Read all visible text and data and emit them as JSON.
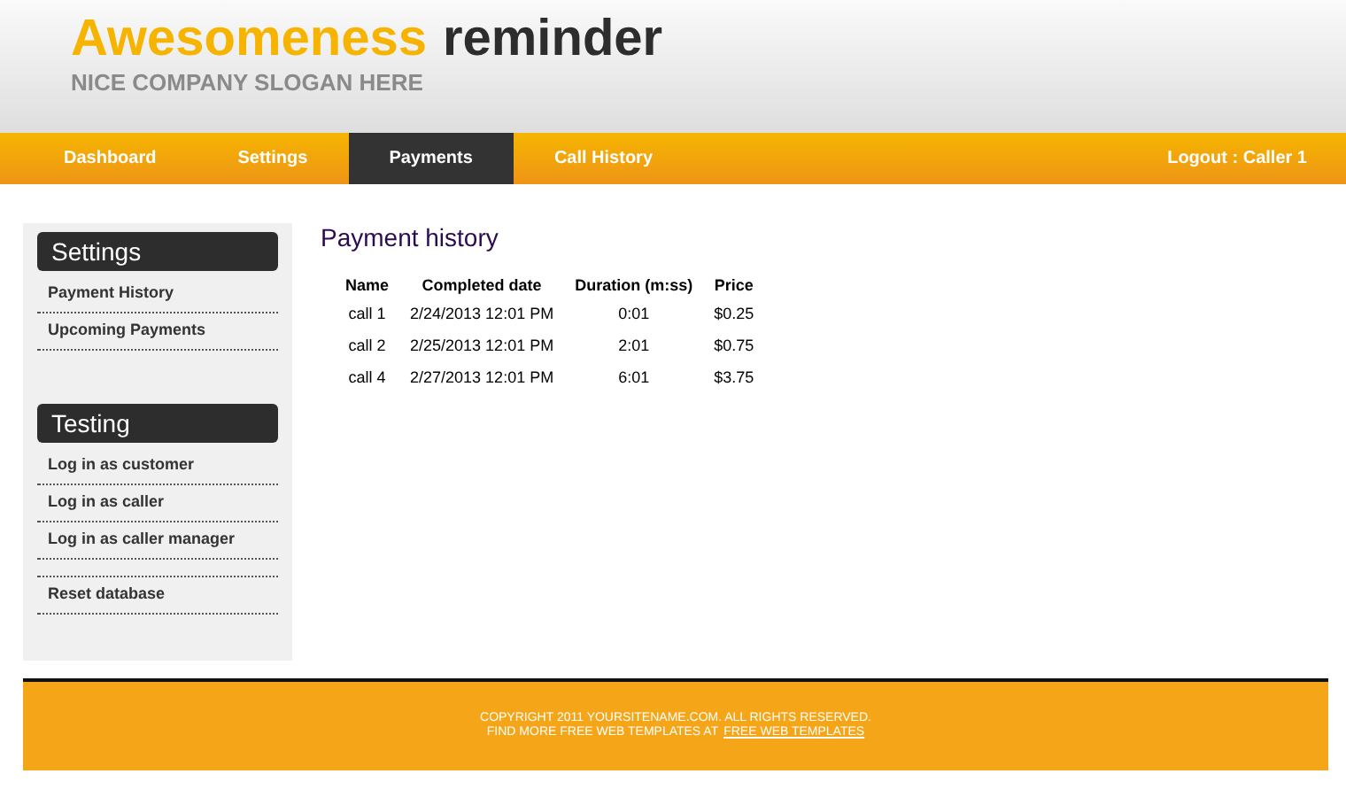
{
  "header": {
    "title_accent": "Awesomeness",
    "title_rest": "reminder",
    "slogan": "NICE COMPANY SLOGAN HERE"
  },
  "nav": {
    "items": [
      {
        "label": "Dashboard",
        "selected": false
      },
      {
        "label": "Settings",
        "selected": false
      },
      {
        "label": "Payments",
        "selected": true
      },
      {
        "label": "Call History",
        "selected": false
      }
    ],
    "logout": "Logout : Caller 1"
  },
  "sidebar": {
    "sections": [
      {
        "title": "Settings",
        "items": [
          {
            "kind": "link",
            "label": "Payment History"
          },
          {
            "kind": "link",
            "label": "Upcoming Payments"
          }
        ]
      },
      {
        "title": "Testing",
        "items": [
          {
            "kind": "link",
            "label": "Log in as customer"
          },
          {
            "kind": "link",
            "label": "Log in as caller"
          },
          {
            "kind": "link",
            "label": "Log in as caller manager"
          },
          {
            "kind": "spacer"
          },
          {
            "kind": "link",
            "label": "Reset database"
          }
        ]
      }
    ]
  },
  "content": {
    "heading": "Payment history",
    "table": {
      "columns": [
        "Name",
        "Completed date",
        "Duration (m:ss)",
        "Price"
      ],
      "rows": [
        [
          "call 1",
          "2/24/2013 12:01 PM",
          "0:01",
          "$0.25"
        ],
        [
          "call 2",
          "2/25/2013 12:01 PM",
          "2:01",
          "$0.75"
        ],
        [
          "call 4",
          "2/27/2013 12:01 PM",
          "6:01",
          "$3.75"
        ]
      ]
    }
  },
  "footer": {
    "copyright": "COPYRIGHT 2011 YOURSITENAME.COM. ALL RIGHTS RESERVED.",
    "more": "FIND MORE FREE WEB TEMPLATES AT",
    "link": "FREE WEB TEMPLATES"
  }
}
